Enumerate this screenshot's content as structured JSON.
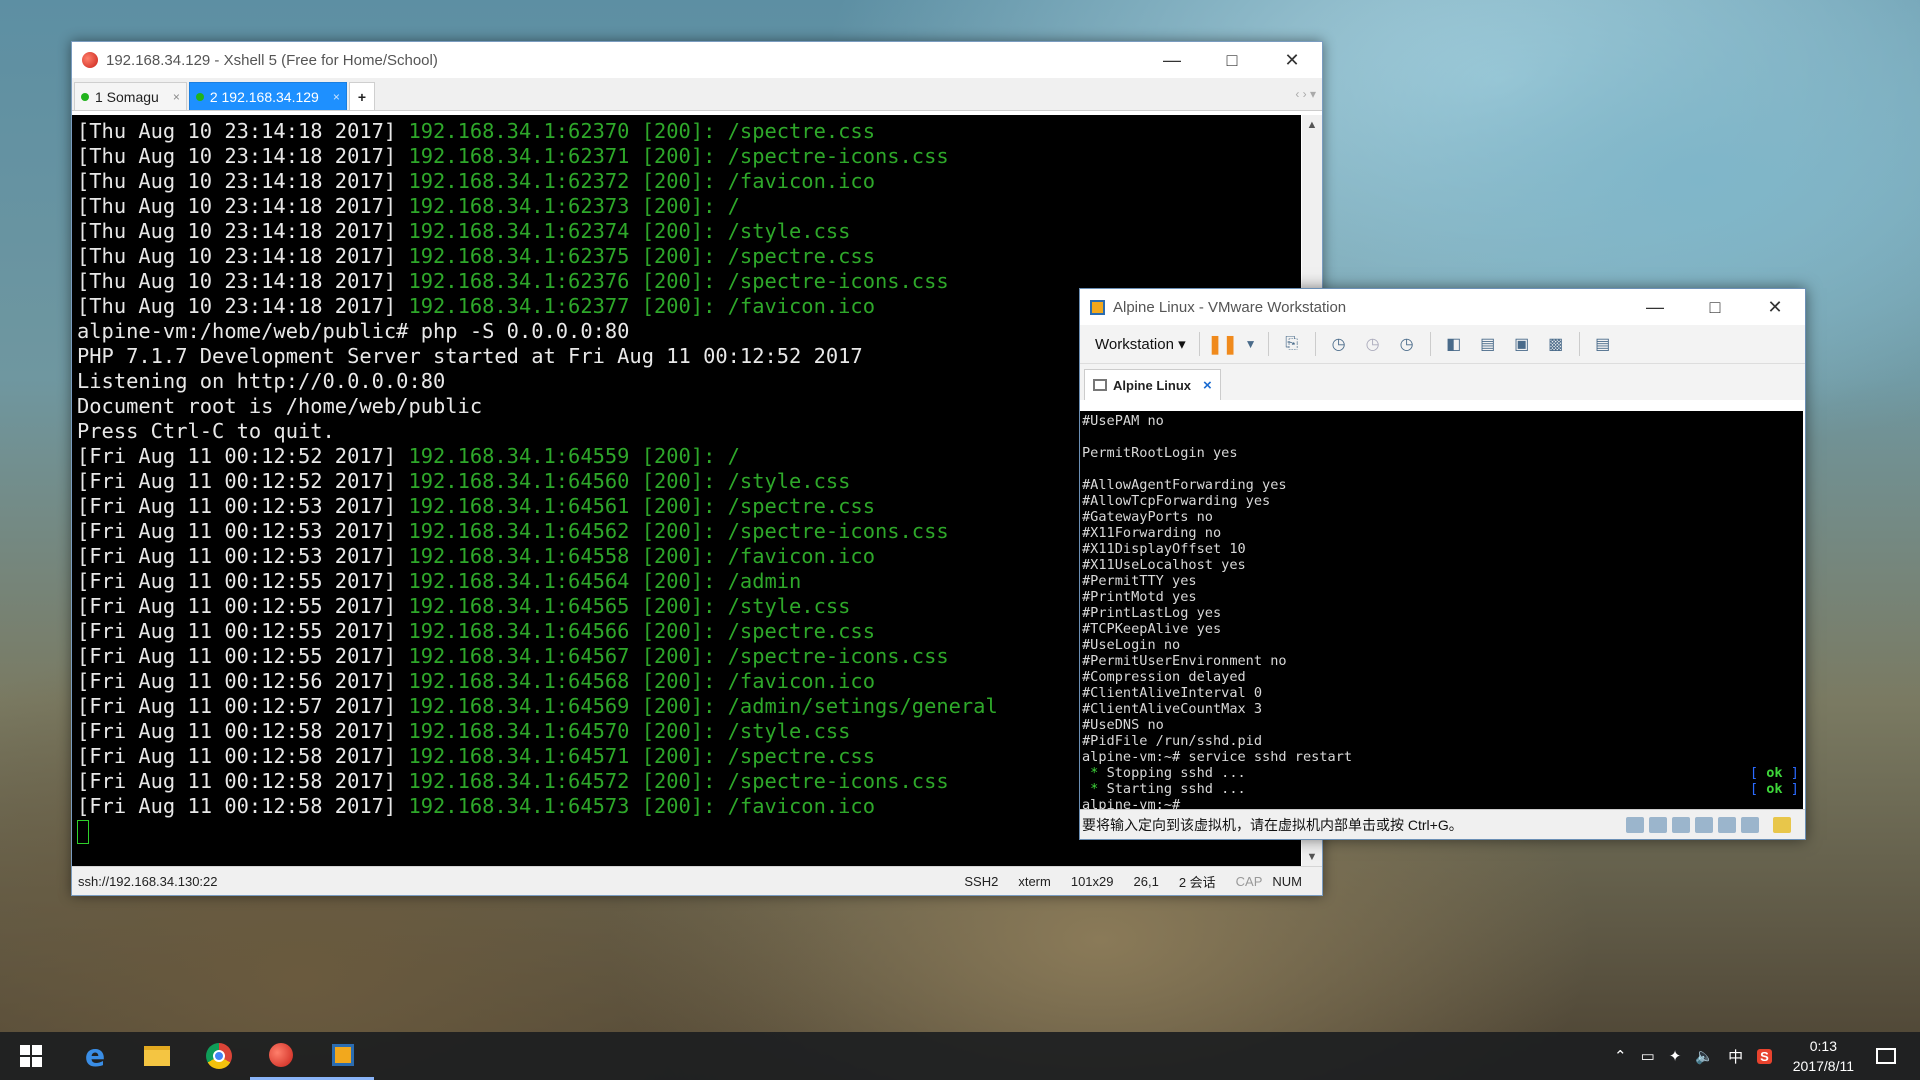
{
  "xshell": {
    "title": "192.168.34.129 - Xshell 5 (Free for Home/School)",
    "tabs": [
      {
        "label": "1 Somagu",
        "close": "×"
      },
      {
        "label": "2 192.168.34.129",
        "close": "×"
      }
    ],
    "add_tab": "+",
    "tab_nav": "‹ › ▾",
    "terminal_lines": [
      {
        "w": "[Thu Aug 10 23:14:18 2017] ",
        "g": "192.168.34.1:62370 [200]: /spectre.css"
      },
      {
        "w": "[Thu Aug 10 23:14:18 2017] ",
        "g": "192.168.34.1:62371 [200]: /spectre-icons.css"
      },
      {
        "w": "[Thu Aug 10 23:14:18 2017] ",
        "g": "192.168.34.1:62372 [200]: /favicon.ico"
      },
      {
        "w": "[Thu Aug 10 23:14:18 2017] ",
        "g": "192.168.34.1:62373 [200]: /"
      },
      {
        "w": "[Thu Aug 10 23:14:18 2017] ",
        "g": "192.168.34.1:62374 [200]: /style.css"
      },
      {
        "w": "[Thu Aug 10 23:14:18 2017] ",
        "g": "192.168.34.1:62375 [200]: /spectre.css"
      },
      {
        "w": "[Thu Aug 10 23:14:18 2017] ",
        "g": "192.168.34.1:62376 [200]: /spectre-icons.css"
      },
      {
        "w": "[Thu Aug 10 23:14:18 2017] ",
        "g": "192.168.34.1:62377 [200]: /favicon.ico"
      },
      {
        "w": "alpine-vm:/home/web/public# php -S 0.0.0.0:80",
        "g": ""
      },
      {
        "w": "PHP 7.1.7 Development Server started at Fri Aug 11 00:12:52 2017",
        "g": ""
      },
      {
        "w": "Listening on http://0.0.0.0:80",
        "g": ""
      },
      {
        "w": "Document root is /home/web/public",
        "g": ""
      },
      {
        "w": "Press Ctrl-C to quit.",
        "g": ""
      },
      {
        "w": "[Fri Aug 11 00:12:52 2017] ",
        "g": "192.168.34.1:64559 [200]: /"
      },
      {
        "w": "[Fri Aug 11 00:12:52 2017] ",
        "g": "192.168.34.1:64560 [200]: /style.css"
      },
      {
        "w": "[Fri Aug 11 00:12:53 2017] ",
        "g": "192.168.34.1:64561 [200]: /spectre.css"
      },
      {
        "w": "[Fri Aug 11 00:12:53 2017] ",
        "g": "192.168.34.1:64562 [200]: /spectre-icons.css"
      },
      {
        "w": "[Fri Aug 11 00:12:53 2017] ",
        "g": "192.168.34.1:64558 [200]: /favicon.ico"
      },
      {
        "w": "[Fri Aug 11 00:12:55 2017] ",
        "g": "192.168.34.1:64564 [200]: /admin"
      },
      {
        "w": "[Fri Aug 11 00:12:55 2017] ",
        "g": "192.168.34.1:64565 [200]: /style.css"
      },
      {
        "w": "[Fri Aug 11 00:12:55 2017] ",
        "g": "192.168.34.1:64566 [200]: /spectre.css"
      },
      {
        "w": "[Fri Aug 11 00:12:55 2017] ",
        "g": "192.168.34.1:64567 [200]: /spectre-icons.css"
      },
      {
        "w": "[Fri Aug 11 00:12:56 2017] ",
        "g": "192.168.34.1:64568 [200]: /favicon.ico"
      },
      {
        "w": "[Fri Aug 11 00:12:57 2017] ",
        "g": "192.168.34.1:64569 [200]: /admin/setings/general"
      },
      {
        "w": "[Fri Aug 11 00:12:58 2017] ",
        "g": "192.168.34.1:64570 [200]: /style.css"
      },
      {
        "w": "[Fri Aug 11 00:12:58 2017] ",
        "g": "192.168.34.1:64571 [200]: /spectre.css"
      },
      {
        "w": "[Fri Aug 11 00:12:58 2017] ",
        "g": "192.168.34.1:64572 [200]: /spectre-icons.css"
      },
      {
        "w": "[Fri Aug 11 00:12:58 2017] ",
        "g": "192.168.34.1:64573 [200]: /favicon.ico"
      }
    ],
    "status": {
      "connection": "ssh://192.168.34.130:22",
      "protocol": "SSH2",
      "term": "xterm",
      "size": "101x29",
      "position": "26,1",
      "sessions": "2 会话",
      "cap": "CAP",
      "num": "NUM"
    }
  },
  "vmware": {
    "title": "Alpine Linux - VMware Workstation",
    "menu_label": "Workstation",
    "tab_label": "Alpine Linux",
    "tab_close": "×",
    "console_lines": [
      {
        "t": "#UsePAM no"
      },
      {
        "t": ""
      },
      {
        "t": "PermitRootLogin yes"
      },
      {
        "t": ""
      },
      {
        "t": "#AllowAgentForwarding yes"
      },
      {
        "t": "#AllowTcpForwarding yes"
      },
      {
        "t": "#GatewayPorts no"
      },
      {
        "t": "#X11Forwarding no"
      },
      {
        "t": "#X11DisplayOffset 10"
      },
      {
        "t": "#X11UseLocalhost yes"
      },
      {
        "t": "#PermitTTY yes"
      },
      {
        "t": "#PrintMotd yes"
      },
      {
        "t": "#PrintLastLog yes"
      },
      {
        "t": "#TCPKeepAlive yes"
      },
      {
        "t": "#UseLogin no"
      },
      {
        "t": "#PermitUserEnvironment no"
      },
      {
        "t": "#Compression delayed"
      },
      {
        "t": "#ClientAliveInterval 0"
      },
      {
        "t": "#ClientAliveCountMax 3"
      },
      {
        "t": "#UseDNS no"
      },
      {
        "t": "#PidFile /run/sshd.pid"
      },
      {
        "t": "alpine-vm:~# service sshd restart"
      },
      {
        "star": " * ",
        "t": "Stopping sshd ...",
        "ok": "ok"
      },
      {
        "star": " * ",
        "t": "Starting sshd ...",
        "ok": "ok"
      },
      {
        "t": "alpine-vm:~# _"
      }
    ],
    "status_message": "要将输入定向到该虚拟机，请在虚拟机内部单击或按 Ctrl+G。"
  },
  "taskbar": {
    "ime": "中",
    "sogou": "S",
    "time": "0:13",
    "date": "2017/8/11"
  }
}
